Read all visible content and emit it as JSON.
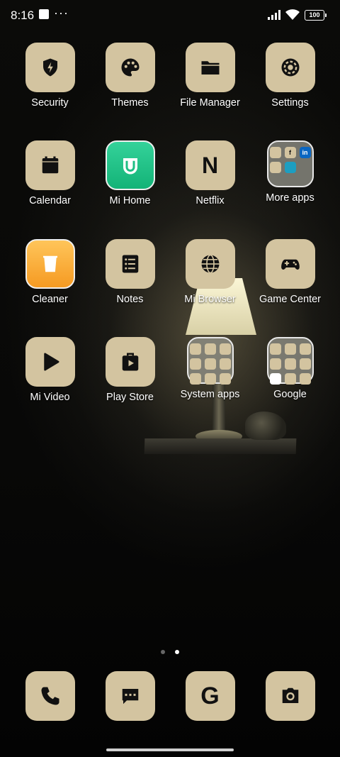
{
  "status_bar": {
    "time": "8:16",
    "dots": "···",
    "battery": "100"
  },
  "apps": [
    {
      "label": "Security",
      "icon": "shield-bolt-icon"
    },
    {
      "label": "Themes",
      "icon": "palette-icon"
    },
    {
      "label": "File Manager",
      "icon": "folder-icon"
    },
    {
      "label": "Settings",
      "icon": "gear-icon"
    },
    {
      "label": "Calendar",
      "icon": "calendar-icon"
    },
    {
      "label": "Mi Home",
      "icon": "mi-home-icon"
    },
    {
      "label": "Netflix",
      "icon": "netflix-icon"
    },
    {
      "label": "More apps",
      "icon": "folder-preview"
    },
    {
      "label": "Cleaner",
      "icon": "trash-icon"
    },
    {
      "label": "Notes",
      "icon": "notes-icon"
    },
    {
      "label": "Mi Browser",
      "icon": "globe-icon"
    },
    {
      "label": "Game Center",
      "icon": "gamepad-icon"
    },
    {
      "label": "Mi Video",
      "icon": "play-icon"
    },
    {
      "label": "Play Store",
      "icon": "bag-play-icon"
    },
    {
      "label": "System apps",
      "icon": "folder-preview"
    },
    {
      "label": "Google",
      "icon": "folder-preview"
    }
  ],
  "folder_more_apps": {
    "minis": [
      "",
      "f",
      "in",
      "",
      "",
      "",
      "",
      "",
      ""
    ]
  },
  "netflix_letter": "N",
  "page_indicator": {
    "pages": 2,
    "active": 2
  },
  "dock": [
    {
      "icon": "phone-icon"
    },
    {
      "icon": "message-icon"
    },
    {
      "icon": "google-g-icon"
    },
    {
      "icon": "camera-icon"
    }
  ],
  "dock_google_letter": "G",
  "colors": {
    "icon_bg": "#d3c4a0",
    "icon_fg": "#111111",
    "mihome": "#1fbf84",
    "cleaner": "#f7a92e"
  }
}
